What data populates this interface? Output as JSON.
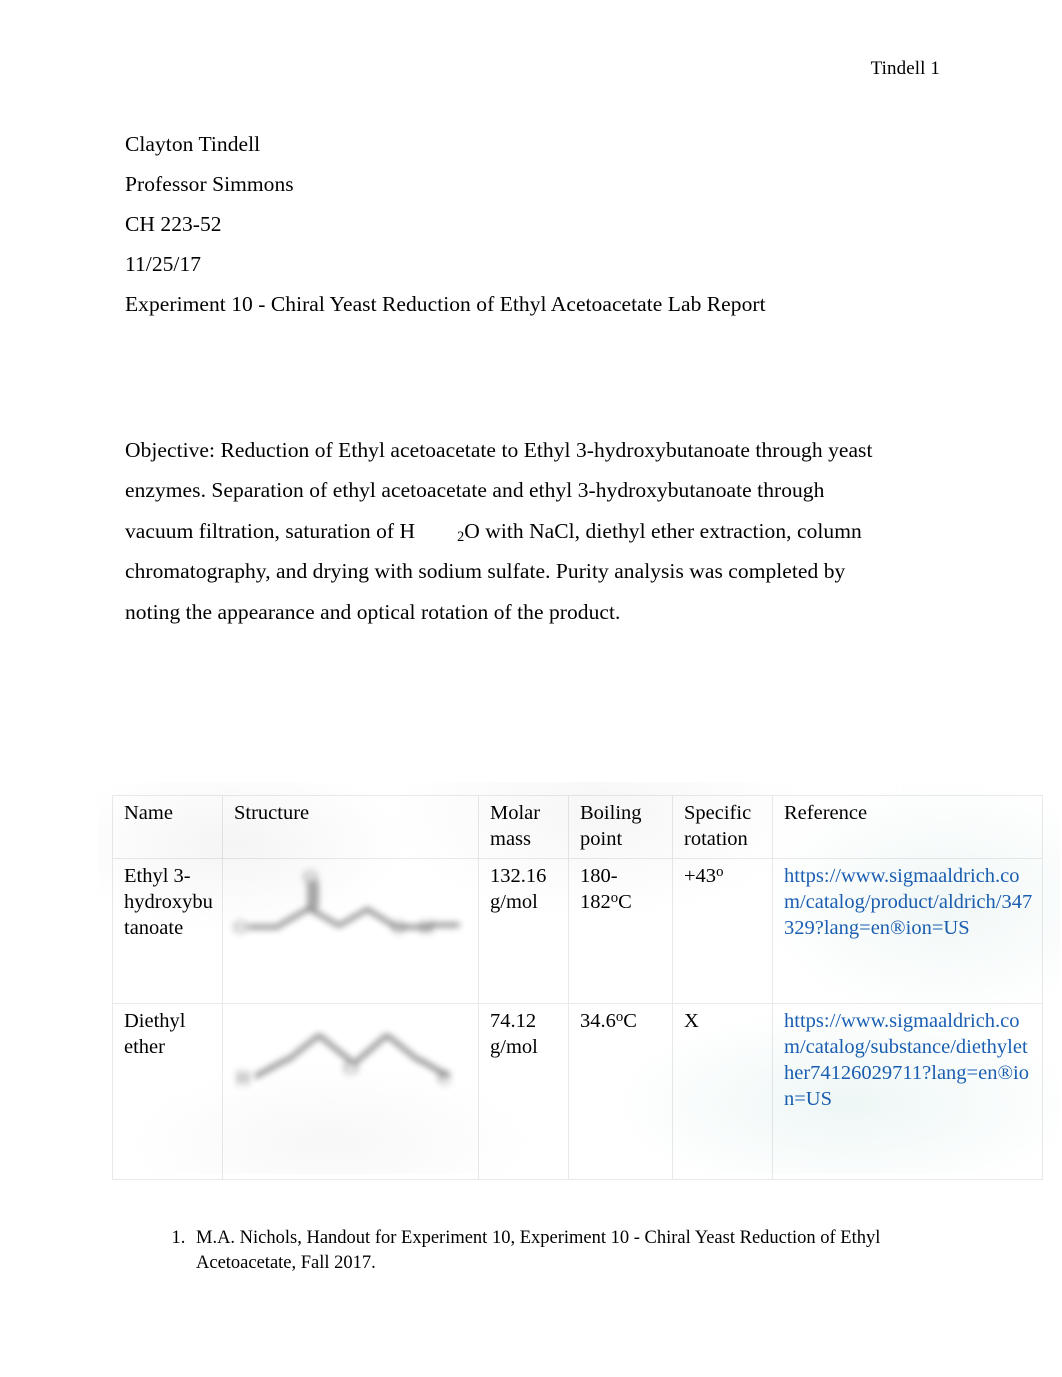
{
  "document": {
    "running_header": "Tindell 1",
    "heading_lines": [
      "Clayton Tindell",
      "Professor Simmons",
      "CH 223-52",
      "11/25/17",
      "Experiment 10 - Chiral Yeast Reduction of Ethyl Acetoacetate Lab Report"
    ],
    "objective": {
      "part_1": "Objective: Reduction of Ethyl acetoacetate to Ethyl 3-hydroxybutanoate through yeast enzymes. Separation of ethyl acetoacetate and ethyl 3-hydroxybutanoate through vacuum filtration, saturation of H",
      "subscript": "2",
      "part_2": "O with NaCl, diethyl ether extraction, column chromatography, and drying with sodium sulfate. Purity analysis was completed by noting the appearance and optical rotation of the product."
    },
    "table": {
      "headers": [
        "Name",
        "Structure",
        "Molar mass",
        "Boiling point",
        "Specific rotation",
        "Reference"
      ],
      "rows": [
        {
          "name": "Ethyl 3-hydroxybutanoate",
          "structure_icon": "ethyl-3-hydroxybutanoate-skeletal-structure",
          "molar_mass": "132.16 g/mol",
          "boiling_point_value": "180-182",
          "boiling_point_unit": "C",
          "specific_rotation_value": "+43",
          "specific_rotation_unit": "",
          "reference": "https://www.sigmaaldrich.com/catalog/product/aldrich/347329?lang=en®ion=US"
        },
        {
          "name": "Diethyl ether",
          "structure_icon": "diethyl-ether-skeletal-structure",
          "molar_mass": "74.12 g/mol",
          "boiling_point_value": "34.6",
          "boiling_point_unit": "C",
          "specific_rotation_value": "X",
          "specific_rotation_unit": "",
          "reference": "https://www.sigmaaldrich.com/catalog/substance/diethylether74126029711?lang=en®ion=US"
        }
      ]
    },
    "footnotes": [
      "M.A. Nichols, Handout for Experiment 10, Experiment 10 - Chiral Yeast Reduction of Ethyl Acetoacetate, Fall 2017."
    ],
    "colors": {
      "link": "#1a5fb4",
      "text": "#000000",
      "table_border": "#e9e9e9",
      "page_background": "#ffffff"
    }
  }
}
